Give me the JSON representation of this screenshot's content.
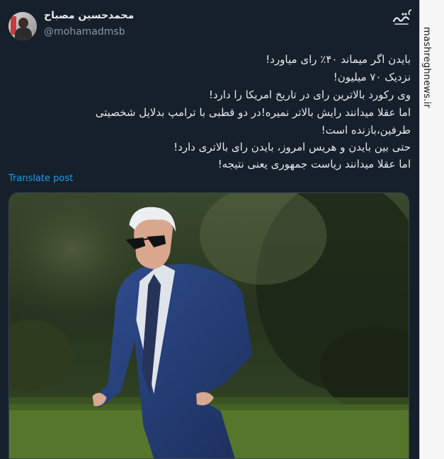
{
  "author": {
    "display_name": "محمدحسین مصباح",
    "handle": "@mohamadmsb"
  },
  "tweet": {
    "lines": [
      "بایدن اگر میماند ۴۰٪ رای میاورد!",
      "نزدیک ۷۰ میلیون!",
      "وی رکورد بالاترین رای در تاریخ امریکا را دارد!",
      "اما عقلا میدانند رایش بالاتر نمیره!در دو قطبی با ترامپ بدلایل شخصیتی",
      "طرفین،بازنده است!",
      "حتی بین بایدن و هریس امروز، بایدن رای بالاتری دارد!",
      "اما عقلا میدانند ریاست جمهوری یعنی نتیجه!"
    ],
    "translate_label": "Translate post"
  },
  "media": {
    "description_icon": "photo-of-man-in-suit-and-sunglasses"
  },
  "watermark": {
    "text": "mashreghnews.ir",
    "logo_icon": "mashregh-logo-icon"
  },
  "colors": {
    "background": "#15202b",
    "link": "#1d9bf0",
    "secondary_text": "#8b98a5"
  }
}
